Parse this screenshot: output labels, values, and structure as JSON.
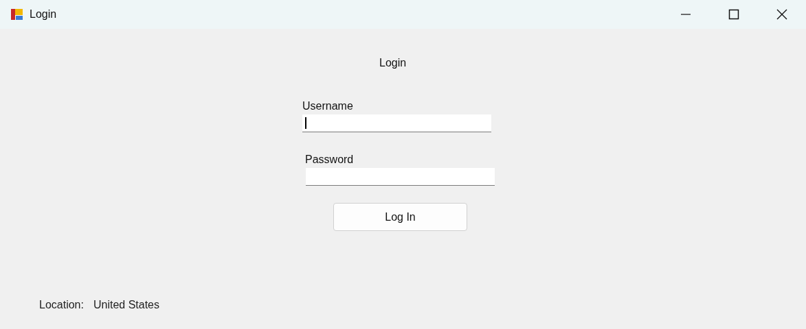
{
  "window": {
    "title": "Login"
  },
  "heading": "Login",
  "fields": [
    {
      "label": "Username",
      "focused": true
    },
    {
      "label": "Password",
      "focused": false
    }
  ],
  "button": "Log In",
  "location": {
    "label": "Location:",
    "value": "United States"
  }
}
